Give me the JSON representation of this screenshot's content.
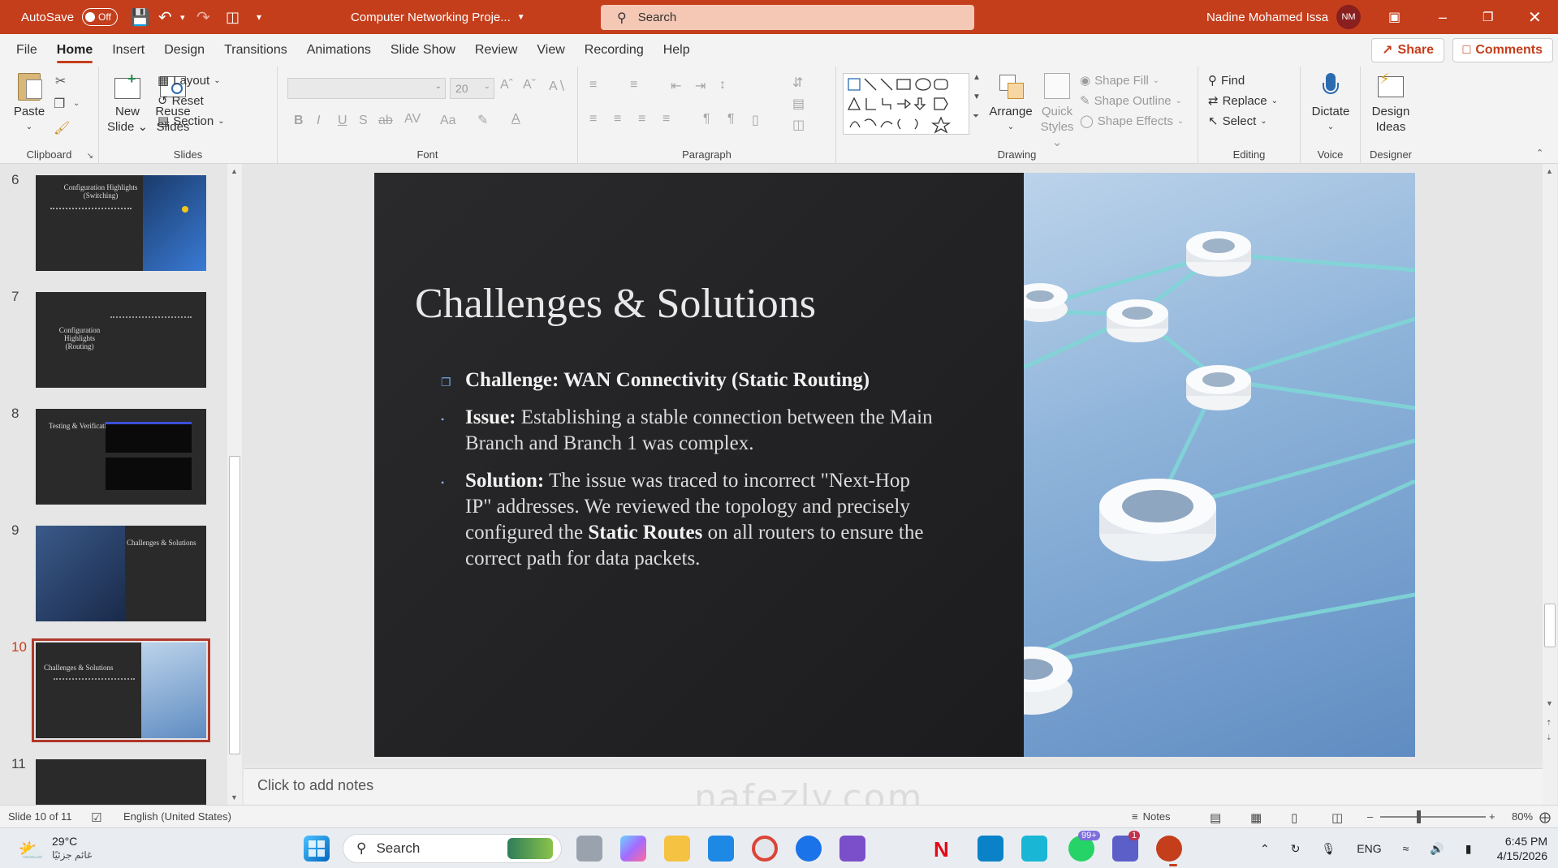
{
  "titlebar": {
    "autosave_label": "AutoSave",
    "autosave_state": "Off",
    "doc_title": "Computer Networking Proje...",
    "search_placeholder": "Search",
    "user_name": "Nadine Mohamed Issa",
    "user_initials": "NM",
    "bg_color": "#c43e1c"
  },
  "menu": {
    "tabs": [
      "File",
      "Home",
      "Insert",
      "Design",
      "Transitions",
      "Animations",
      "Slide Show",
      "Review",
      "View",
      "Recording",
      "Help"
    ],
    "active": "Home",
    "share": "Share",
    "comments": "Comments"
  },
  "ribbon": {
    "clipboard": {
      "label": "Clipboard",
      "paste": "Paste"
    },
    "slides": {
      "label": "Slides",
      "new_slide": "New Slide",
      "reuse": "Reuse Slides",
      "layout": "Layout",
      "reset": "Reset",
      "section": "Section"
    },
    "font": {
      "label": "Font",
      "size": "20"
    },
    "paragraph": {
      "label": "Paragraph"
    },
    "drawing": {
      "label": "Drawing",
      "arrange": "Arrange",
      "quick_styles": "Quick Styles",
      "shape_fill": "Shape Fill",
      "shape_outline": "Shape Outline",
      "shape_effects": "Shape Effects"
    },
    "editing": {
      "label": "Editing",
      "find": "Find",
      "replace": "Replace",
      "select": "Select"
    },
    "voice": {
      "label": "Voice",
      "dictate": "Dictate"
    },
    "designer": {
      "label": "Designer",
      "design_ideas": "Design Ideas"
    }
  },
  "thumbnails": [
    {
      "num": "6",
      "title": "Configuration Highlights (Switching)"
    },
    {
      "num": "7",
      "title": "Configuration Highlights (Routing)"
    },
    {
      "num": "8",
      "title": "Testing & Verification"
    },
    {
      "num": "9",
      "title": "Challenges & Solutions"
    },
    {
      "num": "10",
      "title": "Challenges & Solutions"
    },
    {
      "num": "11",
      "title": ""
    }
  ],
  "slide": {
    "title": "Challenges & Solutions",
    "b1": "Challenge: WAN Connectivity (Static Routing)",
    "b2_label": "Issue:",
    "b2_text": " Establishing a stable connection between the Main Branch and Branch 1 was complex.",
    "b3_label": "Solution:",
    "b3_text1": " The issue was traced to incorrect \"Next-Hop IP\" addresses. We reviewed the topology and precisely configured the ",
    "b3_bold": "Static Routes",
    "b3_text2": " on all routers to ensure the correct path for data packets."
  },
  "notes_placeholder": "Click to add notes",
  "status": {
    "slide_count": "Slide 10 of 11",
    "language": "English (United States)",
    "notes": "Notes",
    "zoom": "80%"
  },
  "taskbar": {
    "temp": "29°C",
    "weather_desc": "غائم جزئيًا",
    "search": "Search",
    "lang": "ENG",
    "time": "6:45 PM",
    "date": "4/15/2026",
    "badge_whatsapp": "99+",
    "badge_teams": "1"
  },
  "watermark": "nafezly.com"
}
